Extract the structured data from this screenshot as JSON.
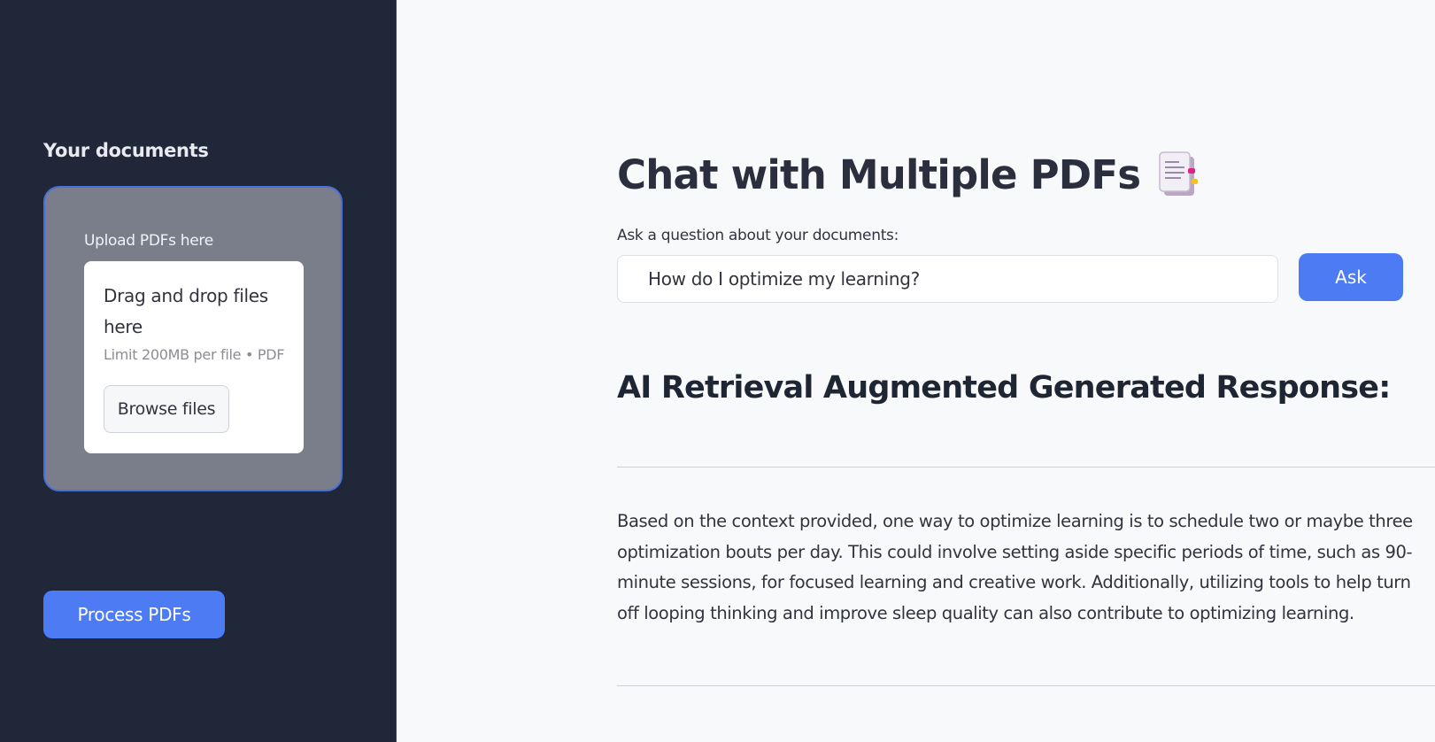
{
  "sidebar": {
    "title": "Your documents",
    "upload": {
      "label": "Upload PDFs here",
      "drop_text": "Drag and drop files here",
      "limit_text": "Limit 200MB per file • PDF",
      "browse_label": "Browse files"
    },
    "process_label": "Process PDFs"
  },
  "main": {
    "title": "Chat with Multiple PDFs",
    "title_icon": "document-icon",
    "question_label": "Ask a question about your documents:",
    "question_value": "How do I optimize my learning?",
    "ask_label": "Ask",
    "response_heading": "AI Retrieval Augmented Generated Response:",
    "response_text": "Based on the context provided, one way to optimize learning is to schedule two or maybe three optimization bouts per day. This could involve setting aside specific periods of time, such as 90-minute sessions, for focused learning and creative work. Additionally, utilizing tools to help turn off looping thinking and improve sleep quality can also contribute to optimizing learning."
  },
  "colors": {
    "sidebar_bg": "#1f2739",
    "main_bg": "#f8f9fb",
    "accent": "#4c7bf4",
    "upload_panel": "#7a7e8a",
    "upload_border": "#4a6fd8"
  }
}
